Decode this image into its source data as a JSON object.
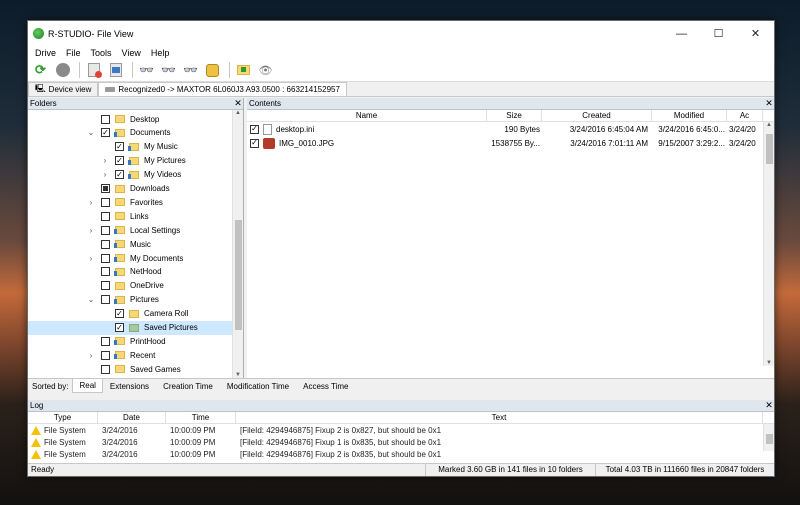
{
  "window": {
    "title": "R-STUDIO- File View",
    "controls": {
      "minimize": "—",
      "maximize": "☐",
      "close": "✕"
    }
  },
  "menu": [
    "Drive",
    "File",
    "Tools",
    "View",
    "Help"
  ],
  "toolbar": {
    "icons": [
      "refresh-icon",
      "stop-icon",
      "open-drive-icon",
      "scan-icon",
      "find-icon",
      "find-next-icon",
      "find-previous-icon",
      "mark-icon",
      "recover-icon",
      "preview-icon"
    ]
  },
  "tabs": [
    {
      "label": "Device view"
    },
    {
      "label": "Recognized0 -> MAXTOR 6L060J3 A93.0500 : 663214152957"
    }
  ],
  "folders": {
    "title": "Folders",
    "items": [
      {
        "label": "Desktop",
        "expander": "",
        "check": "empty",
        "icon": "plain",
        "indent": 0
      },
      {
        "label": "Documents",
        "expander": "⌄",
        "check": "checked",
        "icon": "special",
        "indent": 0
      },
      {
        "label": "My Music",
        "expander": "",
        "check": "checked",
        "icon": "special",
        "indent": 1
      },
      {
        "label": "My Pictures",
        "expander": "›",
        "check": "checked",
        "icon": "special",
        "indent": 1
      },
      {
        "label": "My Videos",
        "expander": "›",
        "check": "checked",
        "icon": "special",
        "indent": 1
      },
      {
        "label": "Downloads",
        "expander": "",
        "check": "partial",
        "icon": "plain",
        "indent": 0
      },
      {
        "label": "Favorites",
        "expander": "›",
        "check": "empty",
        "icon": "plain",
        "indent": 0
      },
      {
        "label": "Links",
        "expander": "",
        "check": "empty",
        "icon": "plain",
        "indent": 0
      },
      {
        "label": "Local Settings",
        "expander": "›",
        "check": "empty",
        "icon": "special",
        "indent": 0
      },
      {
        "label": "Music",
        "expander": "",
        "check": "empty",
        "icon": "special",
        "indent": 0
      },
      {
        "label": "My Documents",
        "expander": "›",
        "check": "empty",
        "icon": "special",
        "indent": 0
      },
      {
        "label": "NetHood",
        "expander": "",
        "check": "empty",
        "icon": "special",
        "indent": 0
      },
      {
        "label": "OneDrive",
        "expander": "",
        "check": "empty",
        "icon": "plain",
        "indent": 0
      },
      {
        "label": "Pictures",
        "expander": "⌄",
        "check": "empty",
        "icon": "special",
        "indent": 0
      },
      {
        "label": "Camera Roll",
        "expander": "",
        "check": "checked",
        "icon": "plain",
        "indent": 1
      },
      {
        "label": "Saved Pictures",
        "expander": "",
        "check": "checked",
        "icon": "green",
        "indent": 1,
        "selected": true
      },
      {
        "label": "PrintHood",
        "expander": "",
        "check": "empty",
        "icon": "special",
        "indent": 0
      },
      {
        "label": "Recent",
        "expander": "›",
        "check": "empty",
        "icon": "special",
        "indent": 0
      },
      {
        "label": "Saved Games",
        "expander": "",
        "check": "empty",
        "icon": "plain",
        "indent": 0
      }
    ]
  },
  "contents": {
    "title": "Contents",
    "columns": [
      "Name",
      "Size",
      "Created",
      "Modified",
      "Ac"
    ],
    "files": [
      {
        "name": "desktop.ini",
        "size": "190 Bytes",
        "created": "3/24/2016 6:45:04 AM",
        "modified": "3/24/2016 6:45:0...",
        "accessed": "3/24/20",
        "icon": "text-file-icon"
      },
      {
        "name": "IMG_0010.JPG",
        "size": "1538755 By...",
        "created": "3/24/2016 7:01:11 AM",
        "modified": "9/15/2007 3:29:2...",
        "accessed": "3/24/20",
        "icon": "image-file-icon"
      }
    ]
  },
  "sortbar": {
    "label": "Sorted by:",
    "tabs": [
      "Real",
      "Extensions",
      "Creation Time",
      "Modification Time",
      "Access Time"
    ]
  },
  "log": {
    "title": "Log",
    "columns": [
      "Type",
      "Date",
      "Time",
      "Text"
    ],
    "rows": [
      {
        "type": "File System",
        "date": "3/24/2016",
        "time": "10:00:09 PM",
        "text": "[FileId: 4294946875] Fixup 2 is 0x827, but should be 0x1"
      },
      {
        "type": "File System",
        "date": "3/24/2016",
        "time": "10:00:09 PM",
        "text": "[FileId: 4294946876] Fixup 1 is 0x835, but should be 0x1"
      },
      {
        "type": "File System",
        "date": "3/24/2016",
        "time": "10:00:09 PM",
        "text": "[FileId: 4294946876] Fixup 2 is 0x835, but should be 0x1"
      }
    ]
  },
  "status": {
    "left": "Ready",
    "marked": "Marked 3.60 GB in 141 files in 10 folders",
    "total": "Total 4.03 TB in 111660 files in 20847 folders"
  }
}
